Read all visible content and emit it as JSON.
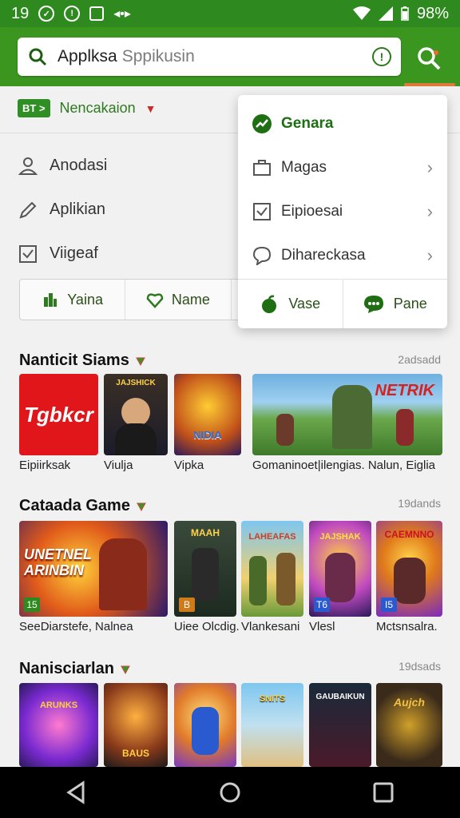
{
  "status_bar": {
    "time": "19",
    "battery": "98%",
    "icons": [
      "circle-check-icon",
      "bolt-icon",
      "square-icon",
      "arrows-icon",
      "wifi-icon",
      "signal-icon",
      "battery-icon"
    ]
  },
  "search": {
    "value": "Applksa",
    "placeholder": "Sppikusin"
  },
  "filter": {
    "chip": "BT >",
    "label": "Nencakaion"
  },
  "left_menu": [
    {
      "label": "Anodasi",
      "icon": "person-icon"
    },
    {
      "label": "Aplikian",
      "icon": "pen-icon"
    },
    {
      "label": "Viigeaf",
      "icon": "checkbox-icon"
    }
  ],
  "tabs": [
    {
      "label": "Yaina",
      "icon": "chart-icon"
    },
    {
      "label": "Name",
      "icon": "heart-icon"
    }
  ],
  "dropdown": {
    "header": "Genara",
    "items": [
      {
        "label": "Magas",
        "icon": "briefcase-icon"
      },
      {
        "label": "Eipioesai",
        "icon": "checkbox-icon"
      },
      {
        "label": "Dihareckasa",
        "icon": "chat-icon"
      }
    ],
    "footer": [
      {
        "label": "Vase",
        "icon": "apple-icon"
      },
      {
        "label": "Pane",
        "icon": "message-icon"
      }
    ]
  },
  "sections": [
    {
      "title": "Nanticit Siams",
      "count": "2adsadd",
      "items": [
        {
          "caption": "Eipiirksak",
          "tile_text": "Tgbkcr"
        },
        {
          "caption": "Viulja",
          "tile_text": "JAJSHICK"
        },
        {
          "caption": "Vipka",
          "tile_text": "NIDIA"
        },
        {
          "caption": "Gomaninoet|ilengias. Nalun, Eiglia",
          "tile_text": "NETRIK"
        }
      ]
    },
    {
      "title": "Cataada Game",
      "count": "19dands",
      "items": [
        {
          "caption": "SeeDiarstefe, Nalnea",
          "tile_text": "UNETNEL ARINBIN",
          "badge": "15"
        },
        {
          "caption": "Uiee Olcdig.",
          "tile_text": "MAAH",
          "badge": "B"
        },
        {
          "caption": "Vlankesani",
          "tile_text": "LAHEAFAS"
        },
        {
          "caption": "Vlesl",
          "tile_text": "JAJSHAK",
          "badge": "T6"
        },
        {
          "caption": "Mctsnsalra.",
          "tile_text": "CAEMNNO",
          "badge": "I5"
        }
      ]
    },
    {
      "title": "Nanisciarlan",
      "count": "19dsads",
      "items": [
        {
          "tile_text": "ARUNKS"
        },
        {
          "tile_text": "BAUS"
        },
        {
          "tile_text": ""
        },
        {
          "tile_text": "SNITS"
        },
        {
          "tile_text": "GAUBAIKUN"
        },
        {
          "tile_text": "Aujch"
        }
      ]
    }
  ],
  "colors": {
    "appbar": "#3a961f",
    "statusbar": "#2e8a1e",
    "accent": "#2e7a1e"
  }
}
